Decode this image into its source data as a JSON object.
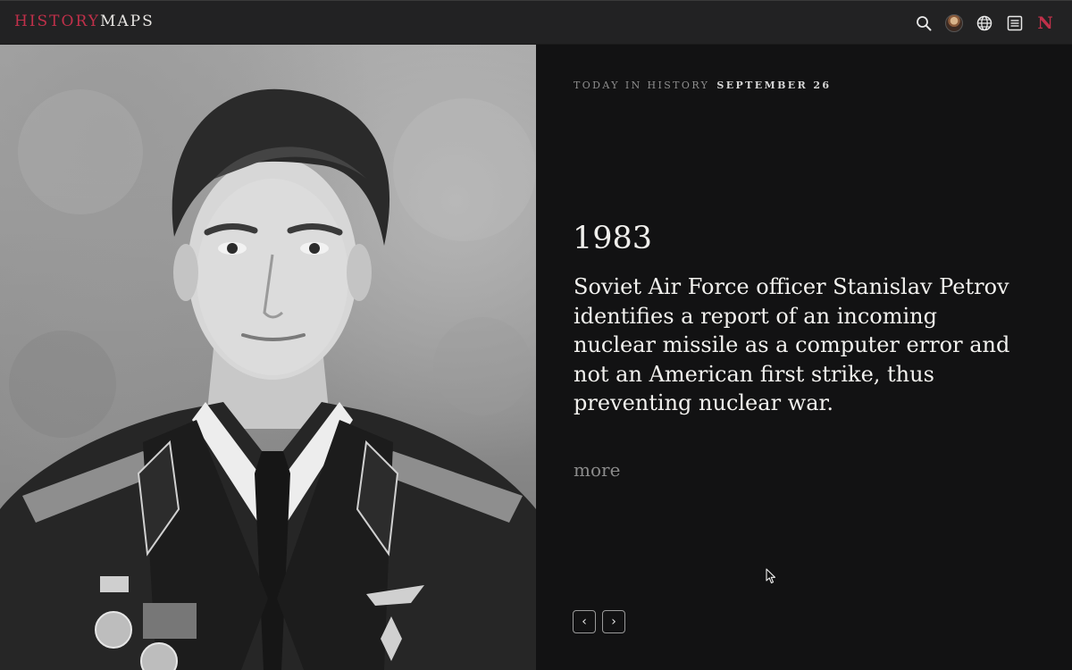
{
  "header": {
    "logo_part1": "HISTORY",
    "logo_part2": "MAPS",
    "icons": [
      "search-icon",
      "avatar",
      "globe-icon",
      "article-list-icon",
      "n-icon"
    ],
    "n_label": "N",
    "accent_color": "#c0304a"
  },
  "portrait": {
    "subject": "portrait-photo"
  },
  "today": {
    "label": "TODAY IN HISTORY",
    "date": "SEPTEMBER 26"
  },
  "event": {
    "year": "1983",
    "text": "Soviet Air Force officer Stanislav Petrov identifies a report of an incoming nuclear missile as a computer error and not an American first strike, thus preventing nuclear war.",
    "more_label": "more"
  },
  "pager": {
    "prev_label": "‹",
    "next_label": "›"
  }
}
